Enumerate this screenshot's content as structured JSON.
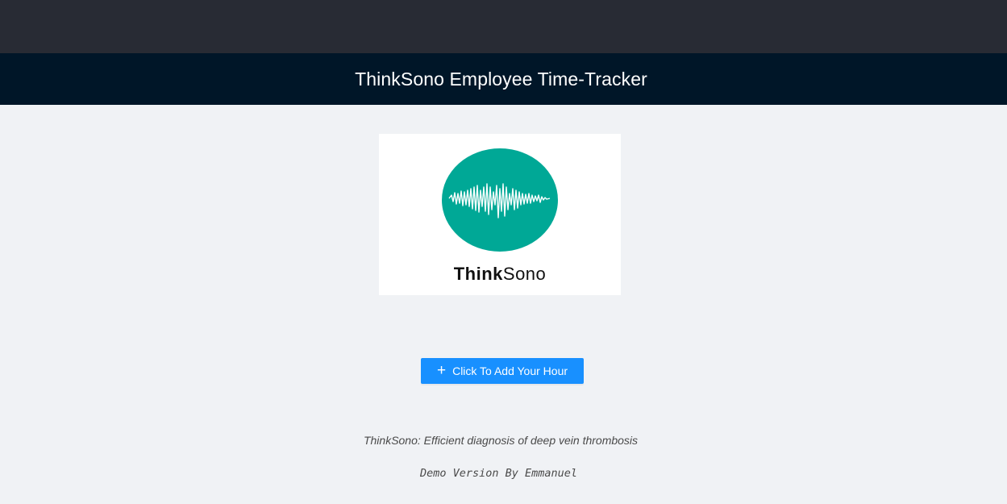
{
  "header": {
    "title": "ThinkSono Employee Time-Tracker"
  },
  "logo": {
    "text_bold": "Think",
    "text_regular": "Sono",
    "circle_color": "#00a896",
    "icon": "soundwave-icon"
  },
  "actions": {
    "add_hour_label": "Click To Add Your Hour",
    "add_hour_icon": "plus-icon"
  },
  "footer": {
    "tagline": "ThinkSono: Efficient diagnosis of deep vein thrombosis",
    "credit": "Demo Version By Emmanuel"
  },
  "colors": {
    "top_bar": "#282b34",
    "header_bg": "#001628",
    "page_bg": "#f0f2f5",
    "primary": "#1890ff"
  }
}
